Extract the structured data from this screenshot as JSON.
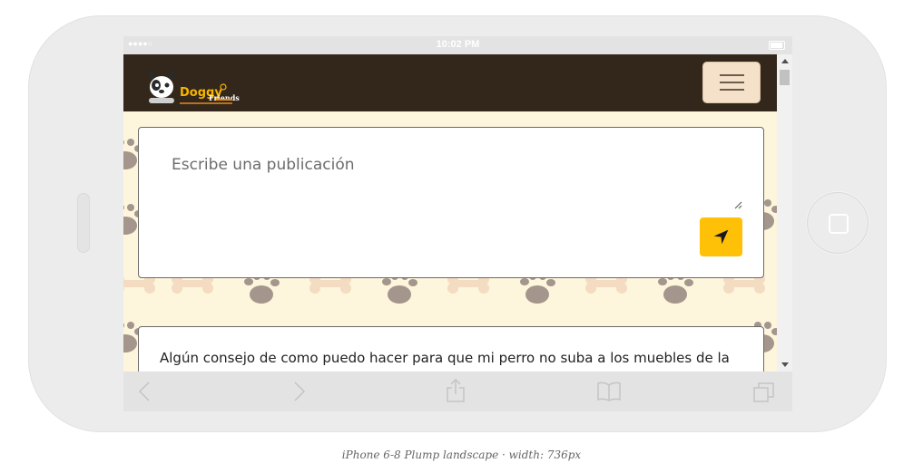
{
  "statusbar": {
    "signal": "●●●●○",
    "time": "10:02 PM"
  },
  "navbar": {
    "logo_text": "Doggy",
    "logo_sub": "Friends",
    "menu_icon": "hamburger-icon"
  },
  "post_form": {
    "placeholder": "Escribe una publicación",
    "submit_icon": "send-arrow-icon",
    "submit_color": "#ffc107"
  },
  "feed": {
    "first_post_text": "Algún consejo de como puedo hacer para que mi perro no suba a los muebles de la"
  },
  "browser_toolbar": {
    "icons": [
      "back-arrow-icon",
      "forward-arrow-icon",
      "share-icon",
      "bookmarks-icon",
      "tabs-icon"
    ]
  },
  "caption": "iPhone 6-8 Plump landscape · width: 736px",
  "colors": {
    "navbar_bg": "#33271b",
    "page_bg": "#fdf5dc",
    "accent": "#ffc107"
  }
}
